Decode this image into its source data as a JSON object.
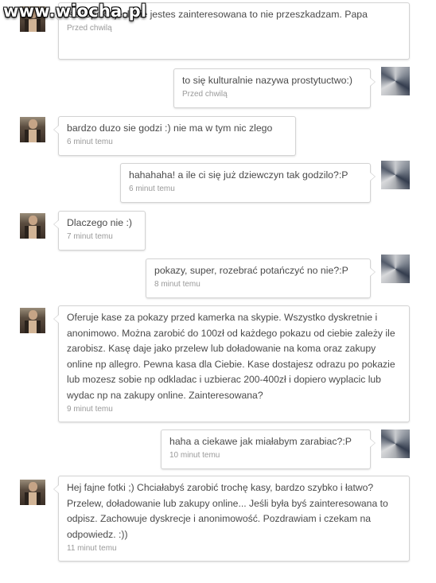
{
  "watermark": "www.wiocha.pl",
  "messages": [
    {
      "side": "left",
      "text": "isz. Spoko jesli nie jestes zainteresowana to nie przeszkadzam. Papa",
      "time": "Przed chwilą"
    },
    {
      "side": "right",
      "text": "to się kulturalnie nazywa prostytuctwo:)",
      "time": "Przed chwilą"
    },
    {
      "side": "left",
      "text": "bardzo duzo sie godzi :) nie ma w tym nic zlego",
      "time": "6 minut temu"
    },
    {
      "side": "right",
      "text": "hahahaha! a ile ci się już dziewczyn tak godzilo?:P",
      "time": "6 minut temu"
    },
    {
      "side": "left",
      "text": "Dlaczego nie :)",
      "time": "7 minut temu"
    },
    {
      "side": "right",
      "text": "pokazy, super, rozebrać potańczyć no nie?:P",
      "time": "8 minut temu"
    },
    {
      "side": "left",
      "text": "Oferuje kase za pokazy przed kamerka na skypie. Wszystko dyskretnie i anonimowo. Można zarobić do 100zł od każdego pokazu od ciebie zależy ile zarobisz. Kasę daje jako przelew lub doładowanie na koma oraz zakupy online np allegro. Pewna kasa dla Ciebie. Kase dostajesz odrazu po pokazie lub mozesz sobie np odkladac i uzbierac 200-400zł i dopiero wyplacic lub wydac np na zakupy online. Zainteresowana?",
      "time": "9 minut temu"
    },
    {
      "side": "right",
      "text": "haha a ciekawe jak miałabym zarabiac?:P",
      "time": "10 minut temu"
    },
    {
      "side": "left",
      "text": "Hej fajne fotki ;) Chciałabyś zarobić trochę kasy, bardzo szybko i łatwo? Przelew, doładowanie lub zakupy online... Jeśli była byś zainteresowana to odpisz. Zachowuje dyskrecje i anonimowość. Pozdrawiam i czekam na odpowiedz. :))",
      "time": "11 minut temu"
    }
  ]
}
